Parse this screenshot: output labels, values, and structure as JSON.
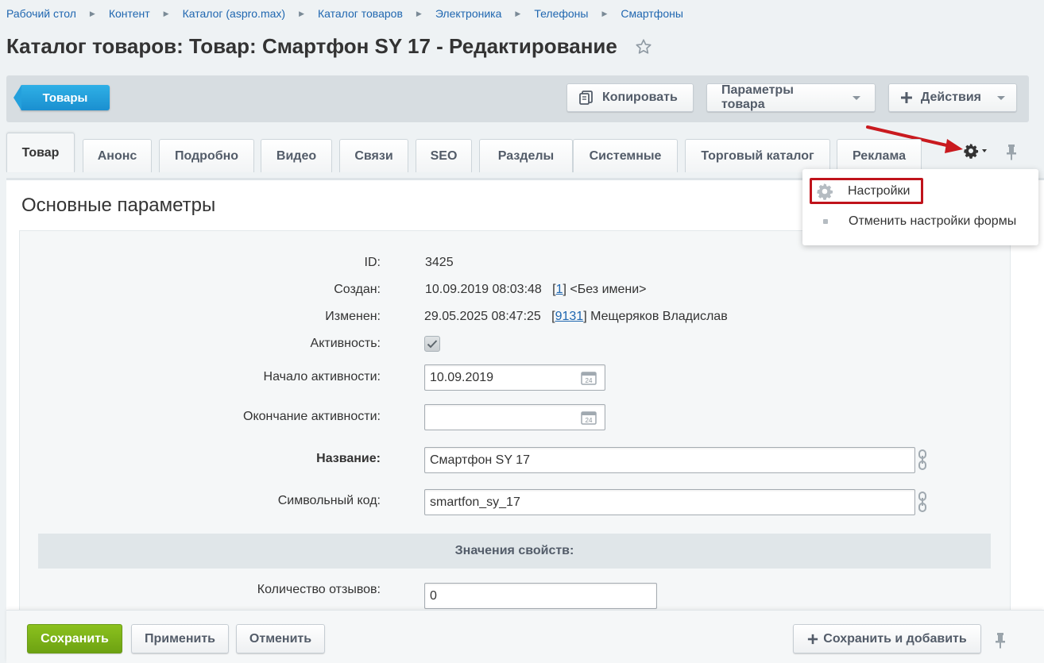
{
  "breadcrumb": [
    "Рабочий стол",
    "Контент",
    "Каталог (aspro.max)",
    "Каталог товаров",
    "Электроника",
    "Телефоны",
    "Смартфоны"
  ],
  "title": "Каталог товаров: Товар: Смартфон SY 17 - Редактирование",
  "toolbar": {
    "back_label": "Товары",
    "copy_label": "Копировать",
    "params_label": "Параметры товара",
    "actions_label": "Действия"
  },
  "tabs": [
    "Товар",
    "Анонс",
    "Подробно",
    "Видео",
    "Связи",
    "SEO",
    "Разделы",
    "Системные",
    "Торговый каталог",
    "Реклама"
  ],
  "settings_menu": {
    "settings": "Настройки",
    "reset": "Отменить настройки формы"
  },
  "section_title": "Основные параметры",
  "fields": {
    "id_label": "ID:",
    "id_value": "3425",
    "created_label": "Создан:",
    "created_date": "10.09.2019 08:03:48",
    "created_user_id": "1",
    "created_user": "<Без имени>",
    "modified_label": "Изменен:",
    "modified_date": "29.05.2025 08:47:25",
    "modified_user_id": "9131",
    "modified_user": "Мещеряков Владислав",
    "active_label": "Активность:",
    "active_checked": true,
    "active_from_label": "Начало активности:",
    "active_from_value": "10.09.2019",
    "active_to_label": "Окончание активности:",
    "active_to_value": "",
    "name_label": "Название:",
    "name_value": "Смартфон SY 17",
    "code_label": "Символьный код:",
    "code_value": "smartfon_sy_17",
    "props_header": "Значения свойств:",
    "reviews_label": "Количество отзывов:",
    "reviews_value": "0"
  },
  "bottom": {
    "save": "Сохранить",
    "apply": "Применить",
    "cancel": "Отменить",
    "save_add": "Сохранить и добавить"
  },
  "colors": {
    "accent_blue": "#1a8fd0",
    "save_green": "#7cb319",
    "highlight_red": "#c0131b"
  }
}
